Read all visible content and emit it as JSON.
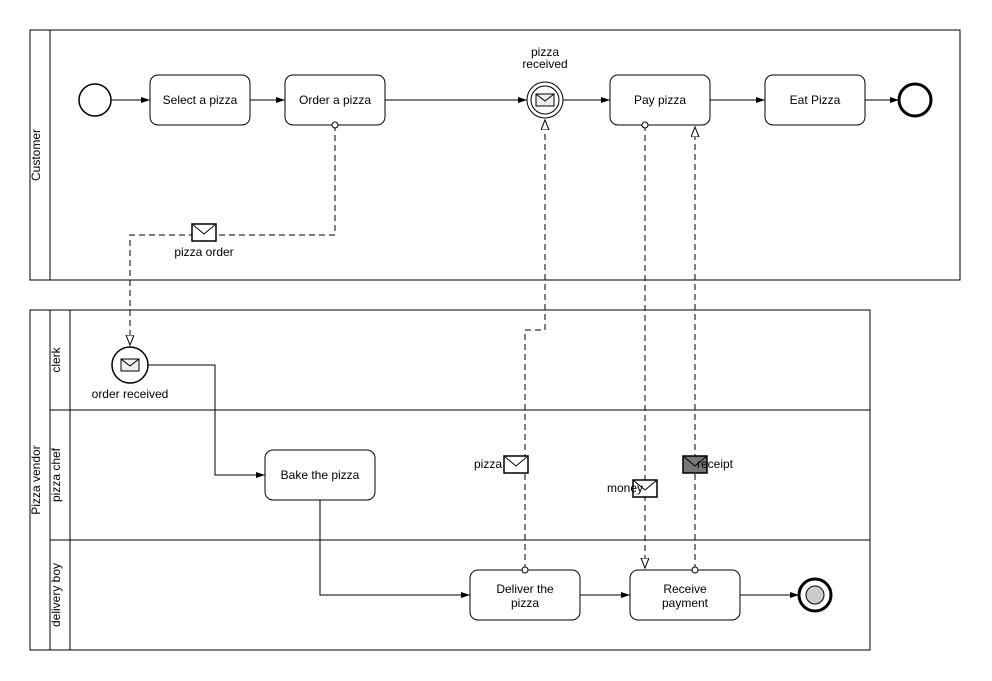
{
  "pools": {
    "customer": "Customer",
    "vendor": "Pizza vendor"
  },
  "lanes": {
    "clerk": "clerk",
    "chef": "pizza chef",
    "delivery": "delivery boy"
  },
  "tasks": {
    "select": "Select a pizza",
    "order": "Order a pizza",
    "pay": "Pay pizza",
    "eat": "Eat Pizza",
    "bake": "Bake the pizza",
    "deliver_line1": "Deliver the",
    "deliver_line2": "pizza",
    "receive_line1": "Receive",
    "receive_line2": "payment"
  },
  "events": {
    "pizza_received_line1": "pizza",
    "pizza_received_line2": "received",
    "order_received": "order received"
  },
  "messages": {
    "pizza_order": "pizza order",
    "pizza": "pizza",
    "money": "money",
    "receipt": "receipt"
  },
  "chart_data": {
    "type": "diagram",
    "notation": "BPMN",
    "participants": [
      {
        "id": "customer",
        "name": "Customer",
        "lanes": []
      },
      {
        "id": "vendor",
        "name": "Pizza vendor",
        "lanes": [
          "clerk",
          "pizza chef",
          "delivery boy"
        ]
      }
    ],
    "nodes": [
      {
        "id": "start_cust",
        "type": "start_event",
        "pool": "customer"
      },
      {
        "id": "select",
        "type": "task",
        "label": "Select a pizza",
        "pool": "customer"
      },
      {
        "id": "order",
        "type": "task",
        "label": "Order a pizza",
        "pool": "customer"
      },
      {
        "id": "pizza_received",
        "type": "intermediate_message_catch",
        "label": "pizza received",
        "pool": "customer"
      },
      {
        "id": "pay",
        "type": "task",
        "label": "Pay pizza",
        "pool": "customer"
      },
      {
        "id": "eat",
        "type": "task",
        "label": "Eat Pizza",
        "pool": "customer"
      },
      {
        "id": "end_cust",
        "type": "end_event",
        "pool": "customer"
      },
      {
        "id": "order_received",
        "type": "message_start_event",
        "label": "order received",
        "pool": "vendor",
        "lane": "clerk"
      },
      {
        "id": "bake",
        "type": "task",
        "label": "Bake the pizza",
        "pool": "vendor",
        "lane": "pizza chef"
      },
      {
        "id": "deliver",
        "type": "task",
        "label": "Deliver the pizza",
        "pool": "vendor",
        "lane": "delivery boy"
      },
      {
        "id": "receive_payment",
        "type": "task",
        "label": "Receive payment",
        "pool": "vendor",
        "lane": "delivery boy"
      },
      {
        "id": "end_vendor",
        "type": "terminate_end_event",
        "pool": "vendor",
        "lane": "delivery boy"
      }
    ],
    "sequence_flows": [
      [
        "start_cust",
        "select"
      ],
      [
        "select",
        "order"
      ],
      [
        "order",
        "pizza_received"
      ],
      [
        "pizza_received",
        "pay"
      ],
      [
        "pay",
        "eat"
      ],
      [
        "eat",
        "end_cust"
      ],
      [
        "order_received",
        "bake"
      ],
      [
        "bake",
        "deliver"
      ],
      [
        "deliver",
        "receive_payment"
      ],
      [
        "receive_payment",
        "end_vendor"
      ]
    ],
    "message_flows": [
      {
        "from": "order",
        "to": "order_received",
        "label": "pizza order"
      },
      {
        "from": "deliver",
        "to": "pizza_received",
        "label": "pizza"
      },
      {
        "from": "pay",
        "to": "receive_payment",
        "label": "money"
      },
      {
        "from": "receive_payment",
        "to": "pay",
        "label": "receipt"
      }
    ]
  }
}
